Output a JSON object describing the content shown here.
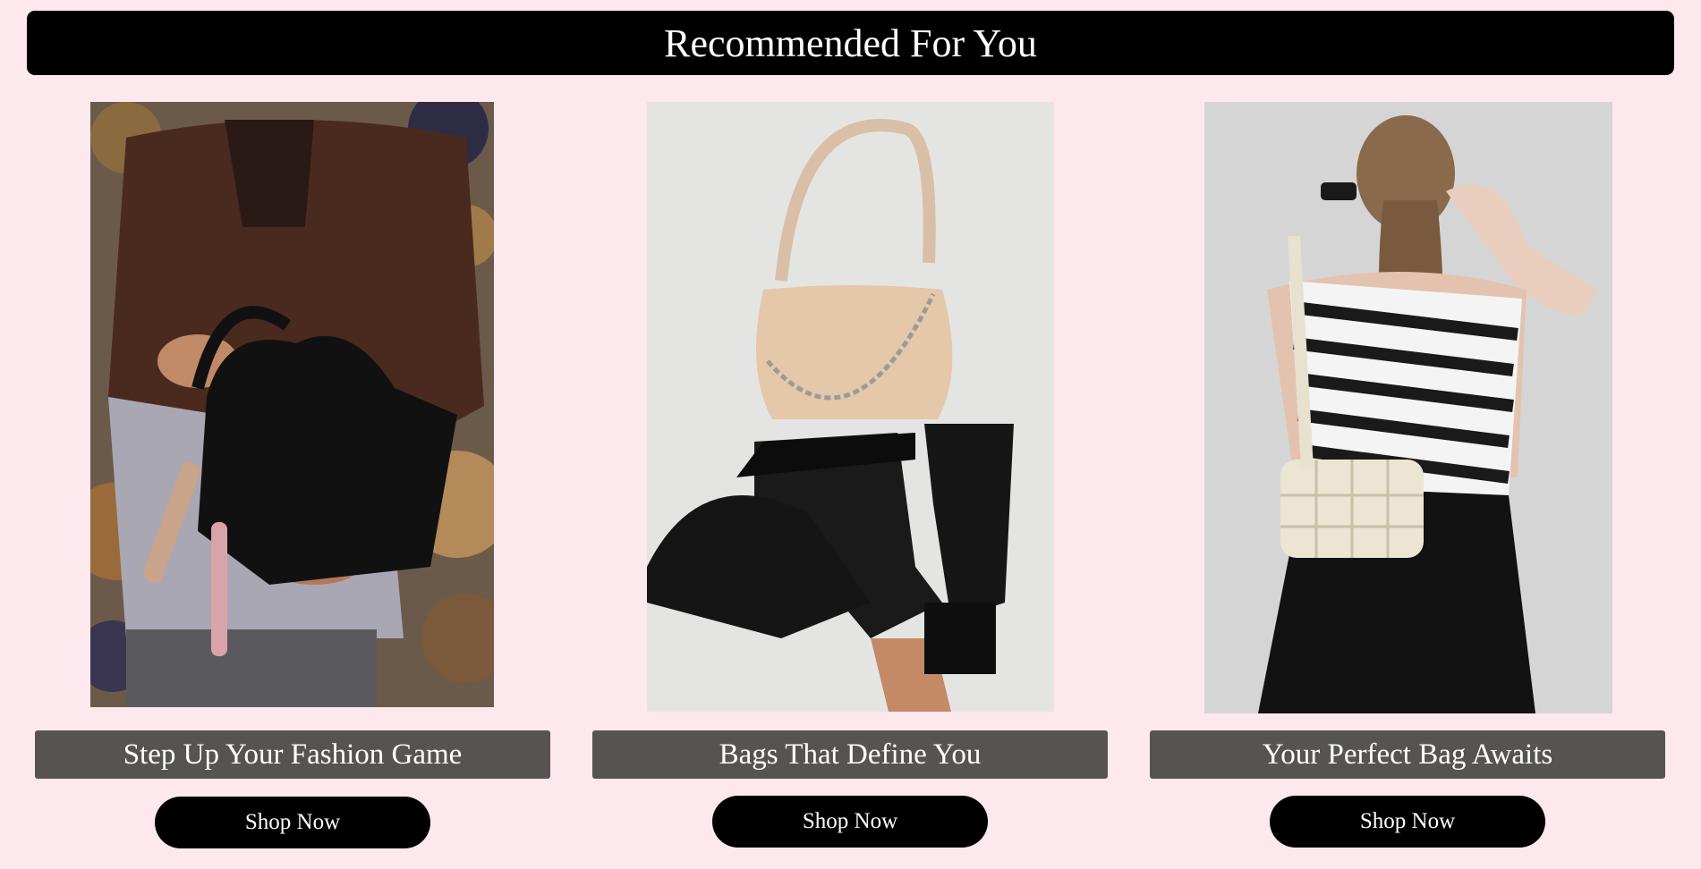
{
  "header": {
    "title": "Recommended For You"
  },
  "cards": [
    {
      "image": "leather-jacket-black-handbag-photo",
      "caption": "Step Up Your Fashion Game",
      "button_label": "Shop Now"
    },
    {
      "image": "beige-shoulder-bag-black-boots-photo",
      "caption": "Bags That Define You",
      "button_label": "Shop Now"
    },
    {
      "image": "woman-ponytail-cream-crossbody-bag-photo",
      "caption": "Your Perfect Bag Awaits",
      "button_label": "Shop Now"
    }
  ],
  "colors": {
    "page_background": "#fde8ee",
    "header_background": "#000000",
    "caption_background": "#585353",
    "button_background": "#000000"
  }
}
